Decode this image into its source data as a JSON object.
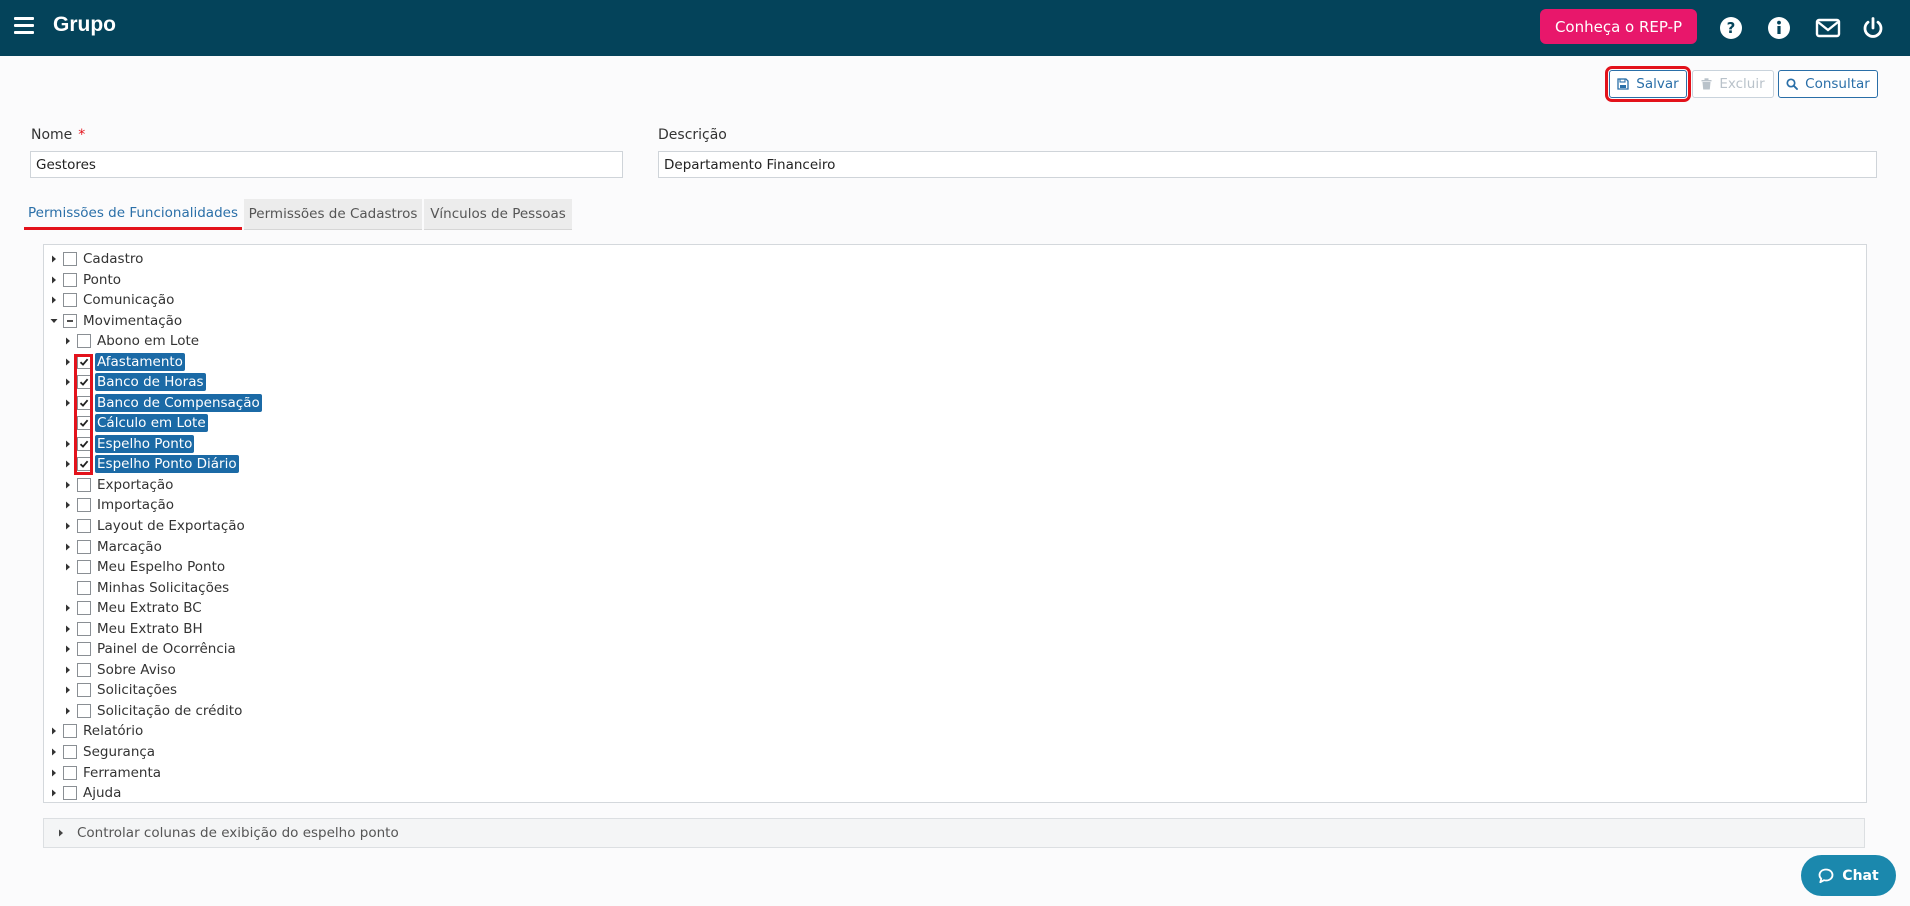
{
  "header": {
    "title": "Grupo",
    "rep_button": "Conheça o REP-P",
    "icons": [
      "menu-icon",
      "help-icon",
      "info-icon",
      "mail-icon",
      "power-icon"
    ]
  },
  "actions": {
    "save": "Salvar",
    "delete": "Excluir",
    "search": "Consultar"
  },
  "form": {
    "name_label": "Nome",
    "name_required": "*",
    "name_value": "Gestores",
    "description_label": "Descrição",
    "description_value": "Departamento Financeiro"
  },
  "tabs": [
    {
      "label": "Permissões de Funcionalidades",
      "active": true
    },
    {
      "label": "Permissões de Cadastros",
      "active": false
    },
    {
      "label": "Vínculos de Pessoas",
      "active": false
    }
  ],
  "tree": [
    {
      "label": "Cadastro",
      "level": 0,
      "state": "unchecked",
      "expander": "collapsed",
      "selected": false
    },
    {
      "label": "Ponto",
      "level": 0,
      "state": "unchecked",
      "expander": "collapsed",
      "selected": false
    },
    {
      "label": "Comunicação",
      "level": 0,
      "state": "unchecked",
      "expander": "collapsed",
      "selected": false
    },
    {
      "label": "Movimentação",
      "level": 0,
      "state": "partial",
      "expander": "expanded",
      "selected": false
    },
    {
      "label": "Abono em Lote",
      "level": 1,
      "state": "unchecked",
      "expander": "collapsed",
      "selected": false
    },
    {
      "label": "Afastamento",
      "level": 1,
      "state": "checked",
      "expander": "collapsed",
      "selected": true
    },
    {
      "label": "Banco de Horas",
      "level": 1,
      "state": "checked",
      "expander": "collapsed",
      "selected": true
    },
    {
      "label": "Banco de Compensação",
      "level": 1,
      "state": "checked",
      "expander": "collapsed",
      "selected": true
    },
    {
      "label": "Cálculo em Lote",
      "level": 1,
      "state": "checked",
      "expander": "none",
      "selected": true
    },
    {
      "label": "Espelho Ponto",
      "level": 1,
      "state": "checked",
      "expander": "collapsed",
      "selected": true
    },
    {
      "label": "Espelho Ponto Diário",
      "level": 1,
      "state": "checked",
      "expander": "collapsed",
      "selected": true
    },
    {
      "label": "Exportação",
      "level": 1,
      "state": "unchecked",
      "expander": "collapsed",
      "selected": false
    },
    {
      "label": "Importação",
      "level": 1,
      "state": "unchecked",
      "expander": "collapsed",
      "selected": false
    },
    {
      "label": "Layout de Exportação",
      "level": 1,
      "state": "unchecked",
      "expander": "collapsed",
      "selected": false
    },
    {
      "label": "Marcação",
      "level": 1,
      "state": "unchecked",
      "expander": "collapsed",
      "selected": false
    },
    {
      "label": "Meu Espelho Ponto",
      "level": 1,
      "state": "unchecked",
      "expander": "collapsed",
      "selected": false
    },
    {
      "label": "Minhas Solicitações",
      "level": 1,
      "state": "unchecked",
      "expander": "none",
      "selected": false
    },
    {
      "label": "Meu Extrato BC",
      "level": 1,
      "state": "unchecked",
      "expander": "collapsed",
      "selected": false
    },
    {
      "label": "Meu Extrato BH",
      "level": 1,
      "state": "unchecked",
      "expander": "collapsed",
      "selected": false
    },
    {
      "label": "Painel de Ocorrência",
      "level": 1,
      "state": "unchecked",
      "expander": "collapsed",
      "selected": false
    },
    {
      "label": "Sobre Aviso",
      "level": 1,
      "state": "unchecked",
      "expander": "collapsed",
      "selected": false
    },
    {
      "label": "Solicitações",
      "level": 1,
      "state": "unchecked",
      "expander": "collapsed",
      "selected": false
    },
    {
      "label": "Solicitação de crédito",
      "level": 1,
      "state": "unchecked",
      "expander": "collapsed",
      "selected": false
    },
    {
      "label": "Relatório",
      "level": 0,
      "state": "unchecked",
      "expander": "collapsed",
      "selected": false
    },
    {
      "label": "Segurança",
      "level": 0,
      "state": "unchecked",
      "expander": "collapsed",
      "selected": false
    },
    {
      "label": "Ferramenta",
      "level": 0,
      "state": "unchecked",
      "expander": "collapsed",
      "selected": false
    },
    {
      "label": "Ajuda",
      "level": 0,
      "state": "unchecked",
      "expander": "collapsed",
      "selected": false
    }
  ],
  "collapsible": {
    "label": "Controlar colunas de exibição do espelho ponto"
  },
  "chat": {
    "label": "Chat"
  },
  "colors": {
    "header_bg": "#04435a",
    "rep_button_bg": "#e8176b",
    "accent_blue": "#2a6fa8",
    "selection_bg": "#1b6aa6",
    "highlight_red": "#e3121b",
    "chat_bg": "#1b88ad"
  }
}
